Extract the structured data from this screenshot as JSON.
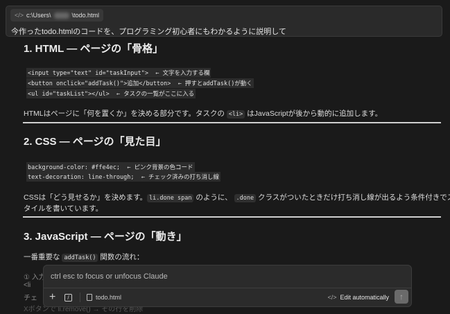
{
  "prompt": {
    "file_prefix": "c:\\Users\\",
    "file_suffix": "\\todo.html",
    "text": "今作ったtodo.htmlのコードを、プログラミング初心者にもわかるように説明して"
  },
  "s1": {
    "title": "1. HTML — ページの「骨格」",
    "code": [
      "<input type=\"text\" id=\"taskInput\">  ← 文字を入力する欄",
      "<button onclick=\"addTask()\">追加</button>  ← 押すとaddTask()が動く",
      "<ul id=\"taskList\"></ul>  ← タスクの一覧がここに入る"
    ],
    "p_a": "HTMLはページに「何を置くか」を決める部分です。タスクの",
    "p_code": "<li>",
    "p_b": "はJavaScriptが後から動的に追加します。"
  },
  "s2": {
    "title": "2. CSS — ページの「見た目」",
    "code": [
      "background-color: #ffe4ec;  ← ピンク背景の色コード",
      "text-decoration: line-through;  ← チェック済みの打ち消し線"
    ],
    "p_a": "CSSは「どう見せるか」を決めます。",
    "c1": "li.done span",
    "p_b": "のように、",
    "c2": ".done",
    "p_c": "クラスがついたときだけ打ち消し線が出るよう条件付きでス",
    "p_d": "タイルを書いています。"
  },
  "s3": {
    "title": "3. JavaScript — ページの「動き」",
    "p_a": "一番重要な",
    "c1": "addTask()",
    "p_b": "関数の流れ：",
    "items": [
      "① 入力",
      "<li",
      "チェ",
      "Xボタンで li.remove() → その行を削除"
    ]
  },
  "composer": {
    "placeholder": "ctrl esc to focus or unfocus Claude",
    "file": "todo.html",
    "edit_mode": "Edit automatically"
  }
}
